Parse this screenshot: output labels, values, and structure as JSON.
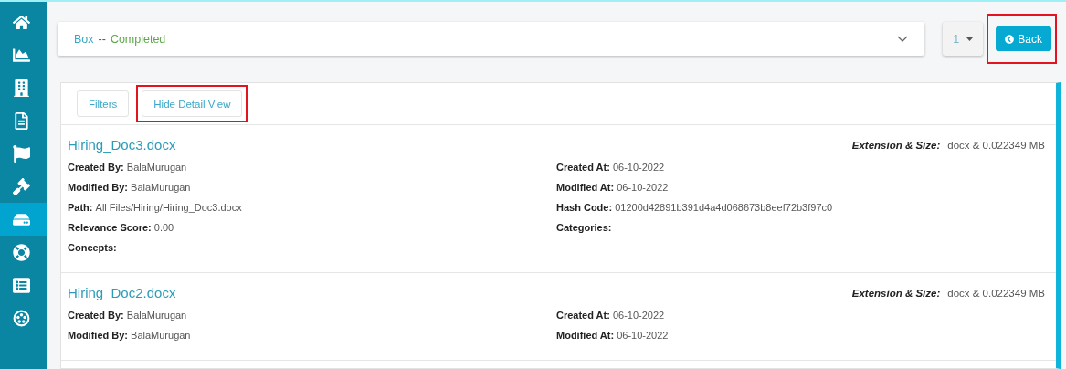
{
  "sidebar": {
    "items": [
      {
        "kind": "home",
        "selected": false
      },
      {
        "kind": "chart",
        "selected": false
      },
      {
        "kind": "building",
        "selected": false
      },
      {
        "kind": "document",
        "selected": false
      },
      {
        "kind": "flag",
        "selected": false
      },
      {
        "kind": "gavel",
        "selected": false
      },
      {
        "kind": "drive",
        "selected": true
      },
      {
        "kind": "lifering",
        "selected": false
      },
      {
        "kind": "list",
        "selected": false
      },
      {
        "kind": "hub",
        "selected": false
      }
    ]
  },
  "header": {
    "source": "Box",
    "separator": "--",
    "status": "Completed",
    "page_select": {
      "value": "1"
    },
    "back_button": {
      "label": "Back",
      "highlighted": true
    }
  },
  "toolbar": {
    "buttons": [
      {
        "label": "Filters",
        "highlighted": false
      },
      {
        "label": "Hide Detail View",
        "highlighted": true
      }
    ]
  },
  "documents": [
    {
      "title": "Hiring_Doc3.docx",
      "extension_label": "Extension & Size:",
      "extension_value": "docx & 0.022349 MB",
      "left": [
        {
          "label": "Created By:",
          "value": "BalaMurugan"
        },
        {
          "label": "Modified By:",
          "value": "BalaMurugan"
        },
        {
          "label": "Path:",
          "value": "All Files/Hiring/Hiring_Doc3.docx"
        },
        {
          "label": "Relevance Score:",
          "value": "0.00"
        },
        {
          "label": "Concepts:"
        }
      ],
      "right": [
        {
          "label": "Created At:",
          "value": "06-10-2022"
        },
        {
          "label": "Modified At:",
          "value": "06-10-2022"
        },
        {
          "label": "Hash Code:",
          "value": "01200d42891b391d4a4d068673b8eef72b3f97c0"
        },
        {
          "label": "Categories:"
        }
      ]
    },
    {
      "title": "Hiring_Doc2.docx",
      "extension_label": "Extension & Size:",
      "extension_value": "docx & 0.022349 MB",
      "left": [
        {
          "label": "Created By:",
          "value": "BalaMurugan"
        },
        {
          "label": "Modified By:",
          "value": "BalaMurugan"
        }
      ],
      "right": [
        {
          "label": "Created At:",
          "value": "06-10-2022"
        },
        {
          "label": "Modified At:",
          "value": "06-10-2022"
        }
      ]
    }
  ]
}
